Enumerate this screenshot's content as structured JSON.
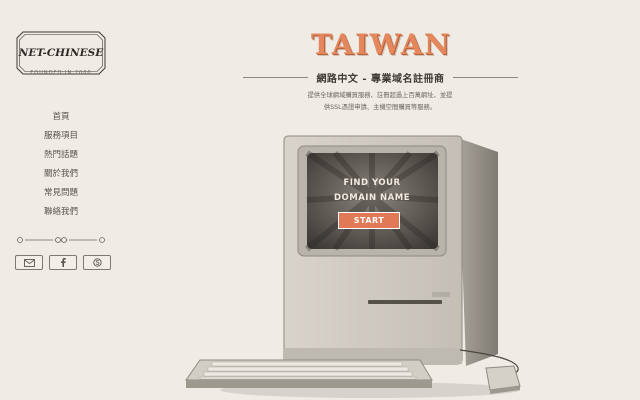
{
  "brand": {
    "logo_text": "NET-CHINESE",
    "founded": "FOUNDED IN 2000"
  },
  "nav": {
    "items": [
      {
        "label": "首頁"
      },
      {
        "label": "服務項目"
      },
      {
        "label": "熱門話題"
      },
      {
        "label": "關於我們"
      },
      {
        "label": "常見問題"
      },
      {
        "label": "聯絡我們"
      }
    ]
  },
  "social": {
    "icons": [
      "mail-icon",
      "facebook-icon",
      "skype-icon"
    ]
  },
  "hero": {
    "title": "TAIWAN",
    "subtitle": "網路中文 - 專業域名註冊商",
    "desc_line1": "提供全球網域購買服務、註冊超過上百萬網址、並提",
    "desc_line2": "供SSL憑證申請、主機空間購買等服務。",
    "screen_line1": "FIND YOUR",
    "screen_line2": "DOMAIN NAME",
    "start_label": "START"
  },
  "colors": {
    "background": "#efece6",
    "accent": "#e27956",
    "title": "#e4875d"
  }
}
